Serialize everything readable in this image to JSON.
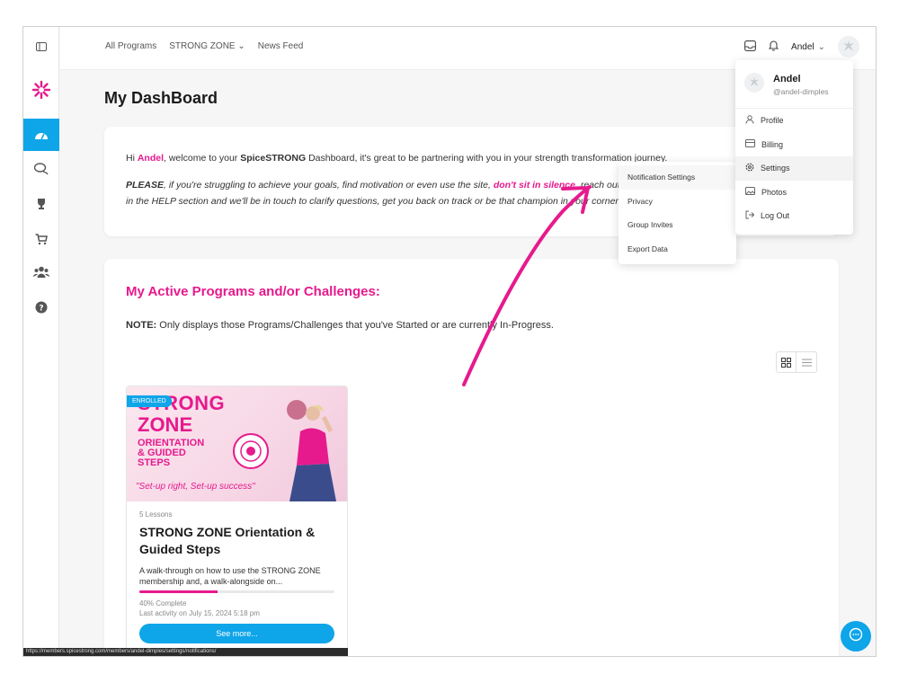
{
  "colors": {
    "accent": "#0ea5e9",
    "brand_pink": "#e61a8d"
  },
  "sidebar": {
    "items": [
      {
        "icon": "panel-toggle-icon"
      },
      {
        "icon": "brand-logo"
      },
      {
        "icon": "dashboard-icon",
        "active": true
      },
      {
        "icon": "chat-bubbles-icon"
      },
      {
        "icon": "trophy-icon"
      },
      {
        "icon": "cart-icon"
      },
      {
        "icon": "group-icon"
      },
      {
        "icon": "help-icon"
      }
    ]
  },
  "topbar": {
    "nav": [
      "All Programs",
      "STRONG ZONE",
      "News Feed"
    ],
    "user_name": "Andel"
  },
  "page": {
    "title": "My DashBoard"
  },
  "welcome": {
    "hi": "Hi ",
    "name": "Andel",
    "line1_mid": ", welcome to your ",
    "brand": "SpiceSTRONG",
    "line1_end": " Dashboard, it's great to be partnering with you in your strength transformation journey.",
    "please": "PLEASE",
    "line2_a": ", if you're struggling to achieve your goals, find motivation or even use the site, ",
    "dont": "don't sit in silence",
    "line2_b": ", reach out to us",
    "line3": "in the HELP section and we'll be in touch to clarify questions, get you back on track or be that champion in your corner."
  },
  "programs": {
    "heading": "My Active Programs and/or Challenges:",
    "note_label": "NOTE:",
    "note_text": " Only displays those Programs/Challenges that you've Started or are currently In-Progress."
  },
  "card": {
    "badge": "ENROLLED",
    "img_line1": "STRONG",
    "img_line2": "ZONE",
    "img_line3": "ORIENTATION",
    "img_line4": "& GUIDED",
    "img_line5": "STEPS",
    "img_tagline": "\"Set-up right, Set-up success\"",
    "lessons": "5 Lessons",
    "title": "STRONG ZONE Orientation & Guided Steps",
    "description": "A walk-through on how to use the STRONG ZONE membership and, a walk-alongside on...",
    "progress_percent": 40,
    "progress_text": "40% Complete",
    "last_activity": "Last activity on July 15, 2024 5:18 pm",
    "button": "See more..."
  },
  "user_menu": {
    "name": "Andel",
    "handle": "@andel-dimples",
    "items": [
      {
        "label": "Profile",
        "icon": "user-icon"
      },
      {
        "label": "Billing",
        "icon": "card-icon"
      },
      {
        "label": "Settings",
        "icon": "gear-icon"
      },
      {
        "label": "Photos",
        "icon": "photo-icon"
      },
      {
        "label": "Log Out",
        "icon": "logout-icon"
      }
    ]
  },
  "settings_submenu": {
    "items": [
      "Notification Settings",
      "Privacy",
      "Group Invites",
      "Export Data"
    ]
  },
  "statusbar": {
    "url": "https://members.spicestrong.com/members/andel-dimples/settings/notifications/"
  }
}
